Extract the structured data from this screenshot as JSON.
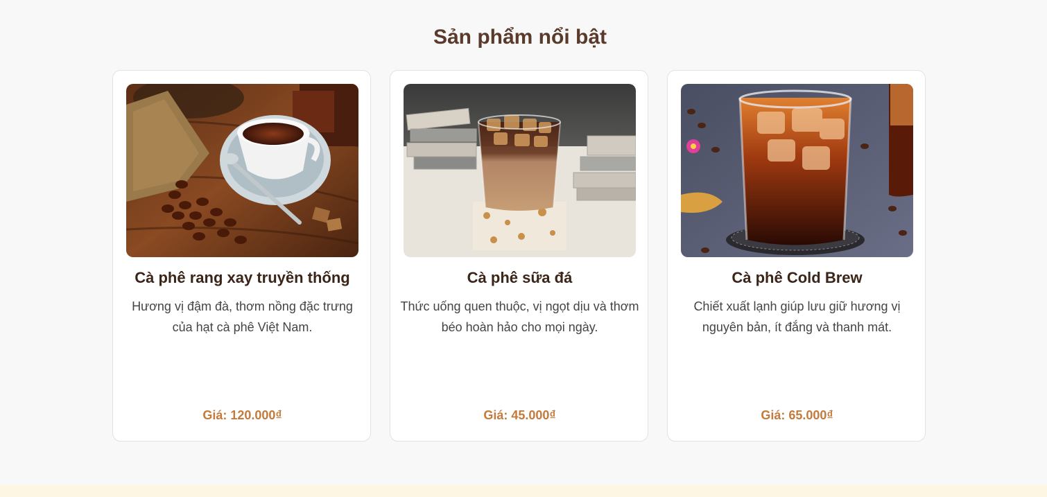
{
  "featured": {
    "title": "Sản phẩm nổi bật",
    "products": [
      {
        "name": "Cà phê rang xay truyền thống",
        "description": "Hương vị đậm đà, thơm nồng đặc trưng của hạt cà phê Việt Nam.",
        "price": "Giá: 120.000₫",
        "image": "coffee-cup-beans-photo"
      },
      {
        "name": "Cà phê sữa đá",
        "description": "Thức uống quen thuộc, vị ngọt dịu và thơm béo hoàn hảo cho mọi ngày.",
        "price": "Giá: 45.000₫",
        "image": "iced-milk-coffee-photo"
      },
      {
        "name": "Cà phê Cold Brew",
        "description": "Chiết xuất lạnh giúp lưu giữ hương vị nguyên bản, ít đắng và thanh mát.",
        "price": "Giá: 65.000₫",
        "image": "cold-brew-glass-photo"
      }
    ]
  },
  "colors": {
    "background": "#f8f8f8",
    "title": "#5a3a2a",
    "price": "#c47a3a",
    "footer_band": "#fdf6e3"
  }
}
